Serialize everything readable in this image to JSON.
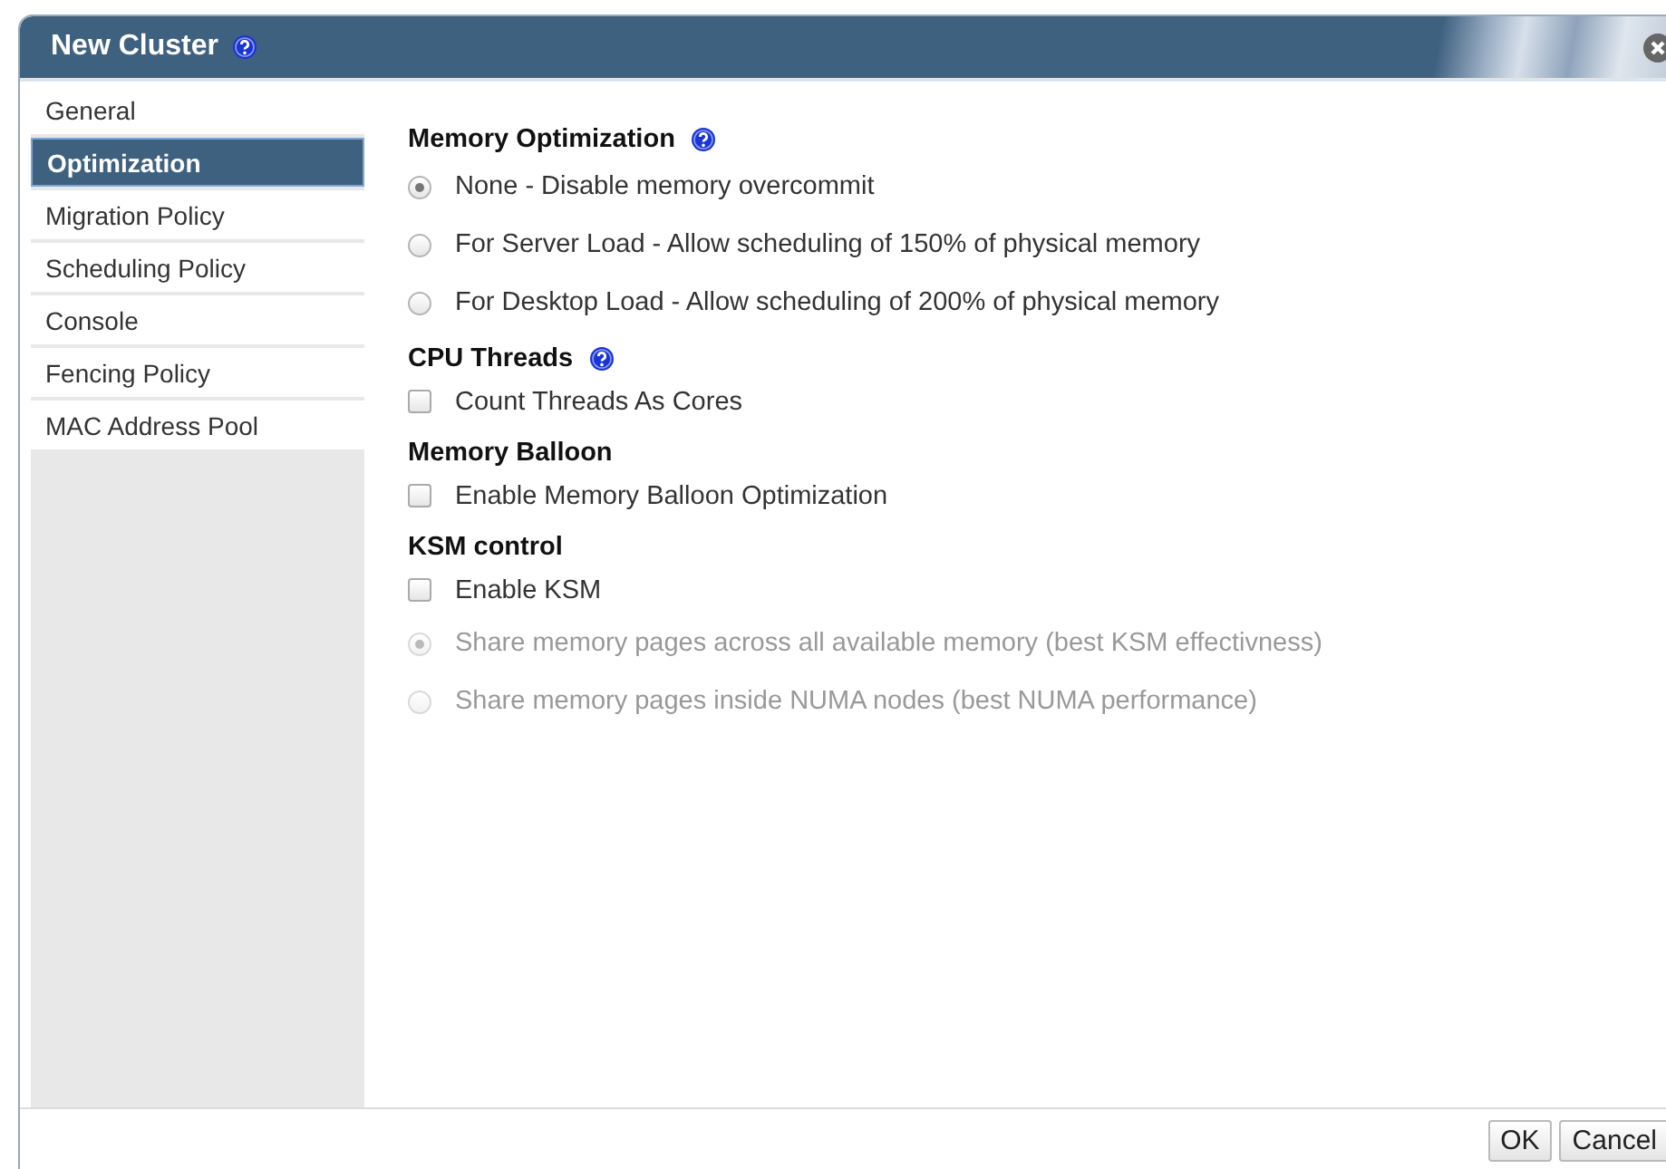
{
  "window": {
    "title": "New Cluster",
    "help": true
  },
  "sidebar": {
    "items": [
      {
        "label": "General",
        "selected": false
      },
      {
        "label": "Optimization",
        "selected": true
      },
      {
        "label": "Migration Policy",
        "selected": false
      },
      {
        "label": "Scheduling Policy",
        "selected": false
      },
      {
        "label": "Console",
        "selected": false
      },
      {
        "label": "Fencing Policy",
        "selected": false
      },
      {
        "label": "MAC Address Pool",
        "selected": false
      }
    ]
  },
  "sections": [
    {
      "title": "Memory Optimization",
      "help": true,
      "options": [
        {
          "kind": "radio",
          "label": "None - Disable memory overcommit",
          "selected": true,
          "disabled": false
        },
        {
          "kind": "radio",
          "label": "For Server Load - Allow scheduling of 150% of physical memory",
          "selected": false,
          "disabled": false
        },
        {
          "kind": "radio",
          "label": "For Desktop Load - Allow scheduling of 200% of physical memory",
          "selected": false,
          "disabled": false
        }
      ]
    },
    {
      "title": "CPU Threads",
      "help": true,
      "options": [
        {
          "kind": "checkbox",
          "label": "Count Threads As Cores",
          "checked": false,
          "disabled": false
        }
      ]
    },
    {
      "title": "Memory Balloon",
      "help": false,
      "options": [
        {
          "kind": "checkbox",
          "label": "Enable Memory Balloon Optimization",
          "checked": false,
          "disabled": false
        }
      ]
    },
    {
      "title": "KSM control",
      "help": false,
      "options": [
        {
          "kind": "checkbox",
          "label": "Enable KSM",
          "checked": false,
          "disabled": false
        },
        {
          "kind": "radio",
          "label": "Share memory pages across all available memory (best KSM effectivness)",
          "selected": true,
          "disabled": true
        },
        {
          "kind": "radio",
          "label": "Share memory pages inside NUMA nodes (best NUMA performance)",
          "selected": false,
          "disabled": true
        }
      ]
    }
  ],
  "buttons": [
    "OK",
    "Cancel"
  ]
}
